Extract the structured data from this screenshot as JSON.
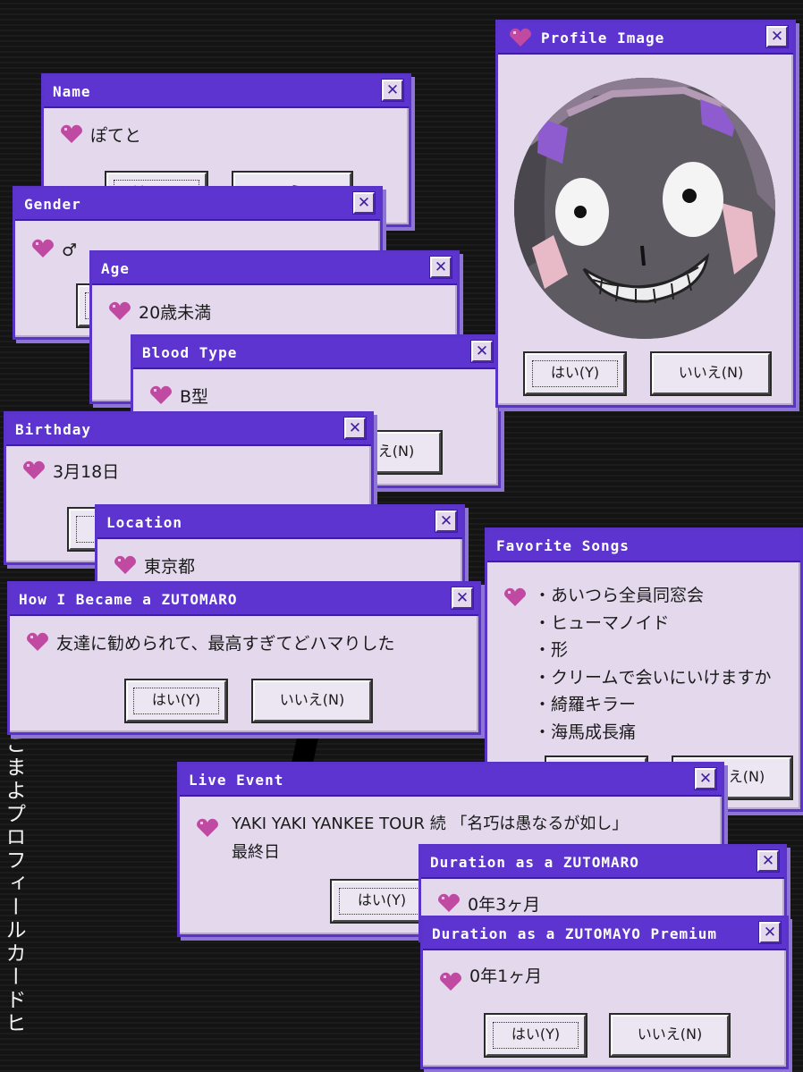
{
  "side_text": "こまよプロフィールカードヒ",
  "buttons": {
    "yes": "はい(Y)",
    "no": "いいえ(N)"
  },
  "dialogs": {
    "name": {
      "title": "Name",
      "value": "ぽてと"
    },
    "gender": {
      "title": "Gender",
      "value": "♂"
    },
    "age": {
      "title": "Age",
      "value": "20歳未満"
    },
    "blood_type": {
      "title": "Blood Type",
      "value": "B型"
    },
    "birthday": {
      "title": "Birthday",
      "value": "3月18日"
    },
    "location": {
      "title": "Location",
      "value": "東京都"
    },
    "how_became": {
      "title": "How I Became a ZUTOMARO",
      "value": "友達に勧められて、最高すぎてどハマりした"
    },
    "profile_image": {
      "title": "Profile Image"
    },
    "favorite_songs": {
      "title": "Favorite Songs",
      "songs": [
        "あいつら全員同窓会",
        "ヒューマノイド",
        "形",
        "クリームで会いにいけますか",
        "綺羅キラー",
        "海馬成長痛"
      ]
    },
    "live_event": {
      "title": "Live Event",
      "line1": "YAKI YAKI YANKEE TOUR 続 「名巧は愚なるが如し」",
      "line2": "最終日"
    },
    "duration": {
      "title": "Duration as a ZUTOMARO",
      "value": "0年3ヶ月"
    },
    "duration_premium": {
      "title": "Duration as a ZUTOMAYO Premium",
      "value": "0年1ヶ月"
    }
  },
  "colors": {
    "titlebar": "#5d34cf",
    "window_bg": "#e3d8ec",
    "heart": "#c04aa2",
    "background": "#141414"
  }
}
